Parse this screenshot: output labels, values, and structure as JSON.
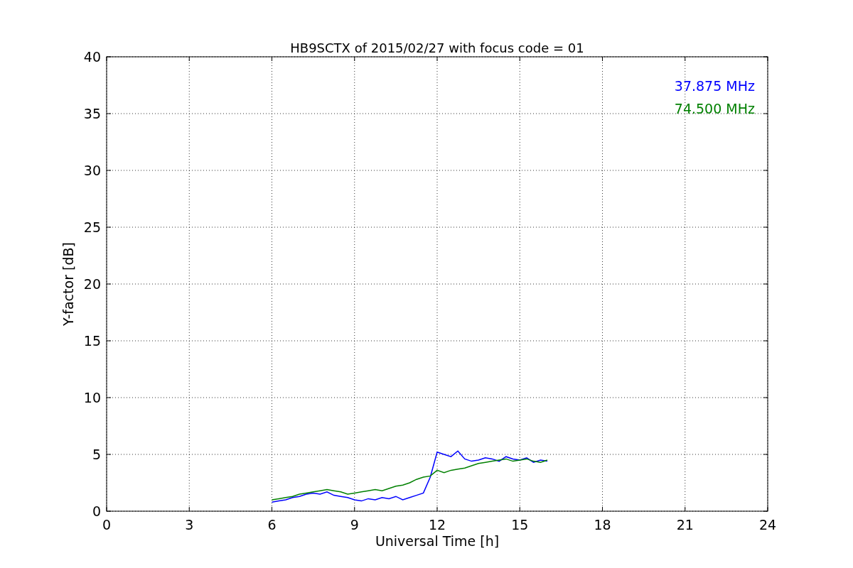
{
  "chart_data": {
    "type": "line",
    "title": "HB9SCTX of 2015/02/27 with focus code = 01",
    "xlabel": "Universal Time [h]",
    "ylabel": "Y-factor [dB]",
    "x": [
      6,
      6.25,
      6.5,
      6.75,
      7,
      7.25,
      7.5,
      7.75,
      8,
      8.25,
      8.5,
      8.75,
      9,
      9.25,
      9.5,
      9.75,
      10,
      10.25,
      10.5,
      10.75,
      11,
      11.25,
      11.5,
      11.75,
      12,
      12.25,
      12.5,
      12.75,
      13,
      13.25,
      13.5,
      13.75,
      14,
      14.25,
      14.5,
      14.75,
      15,
      15.25,
      15.5,
      15.75,
      16
    ],
    "series": [
      {
        "name": "37.875 MHz",
        "color": "#0000ff",
        "values": [
          0.8,
          0.9,
          1.0,
          1.2,
          1.3,
          1.5,
          1.6,
          1.5,
          1.7,
          1.4,
          1.3,
          1.2,
          1.0,
          0.9,
          1.1,
          1.0,
          1.2,
          1.1,
          1.3,
          1.0,
          1.2,
          1.4,
          1.6,
          3.0,
          5.2,
          5.0,
          4.8,
          5.3,
          4.6,
          4.4,
          4.5,
          4.7,
          4.6,
          4.4,
          4.8,
          4.6,
          4.5,
          4.7,
          4.3,
          4.5,
          4.4
        ]
      },
      {
        "name": "74.500 MHz",
        "color": "#008000",
        "values": [
          1.0,
          1.1,
          1.2,
          1.3,
          1.5,
          1.6,
          1.7,
          1.8,
          1.9,
          1.8,
          1.7,
          1.5,
          1.6,
          1.7,
          1.8,
          1.9,
          1.8,
          2.0,
          2.2,
          2.3,
          2.5,
          2.8,
          3.0,
          3.1,
          3.6,
          3.4,
          3.6,
          3.7,
          3.8,
          4.0,
          4.2,
          4.3,
          4.4,
          4.5,
          4.6,
          4.4,
          4.5,
          4.6,
          4.4,
          4.3,
          4.5
        ]
      }
    ],
    "grid": true,
    "xlim": [
      0,
      24
    ],
    "ylim": [
      0,
      40
    ],
    "xticks": [
      0,
      3,
      6,
      9,
      12,
      15,
      18,
      21,
      24
    ],
    "yticks": [
      0,
      5,
      10,
      15,
      20,
      25,
      30,
      35,
      40
    ]
  }
}
